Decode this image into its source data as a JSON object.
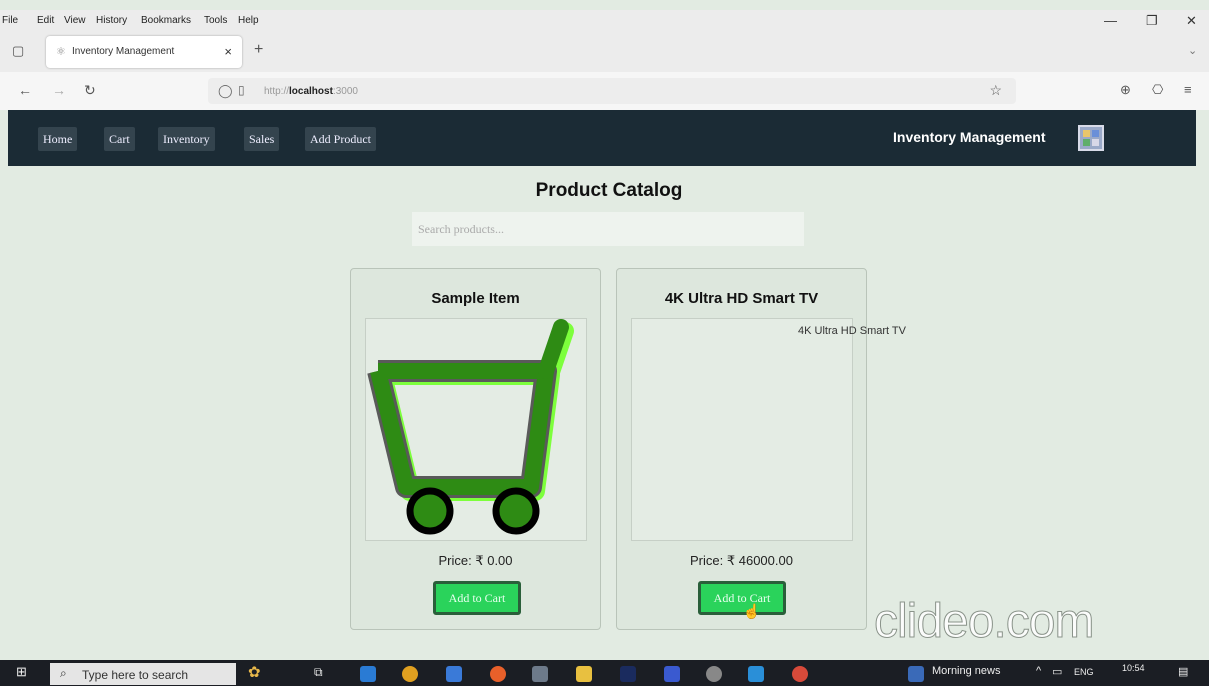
{
  "browser": {
    "menu": [
      "File",
      "Edit",
      "View",
      "History",
      "Bookmarks",
      "Tools",
      "Help"
    ],
    "tab_title": "Inventory Management",
    "url_prefix": "http://",
    "url_host": "localhost",
    "url_port": ":3000"
  },
  "nav": {
    "links": [
      "Home",
      "Cart",
      "Inventory",
      "Sales",
      "Add Product"
    ],
    "brand": "Inventory Management"
  },
  "page": {
    "title": "Product Catalog",
    "search_placeholder": "Search products..."
  },
  "products": [
    {
      "name": "Sample Item",
      "image_alt": "",
      "price": "Price: ₹ 0.00",
      "button": "Add to Cart"
    },
    {
      "name": "4K Ultra HD Smart TV",
      "image_alt": "4K Ultra HD Smart TV",
      "price": "Price: ₹ 46000.00",
      "button": "Add to Cart"
    }
  ],
  "watermark": "clideo.com",
  "taskbar": {
    "search_placeholder": "Type here to search",
    "news": "Morning news",
    "lang": "ENG",
    "time": "10:54"
  },
  "colors": {
    "nav_bg": "#1b2b35",
    "button_bg": "#2ad35b",
    "cart_green": "#2e8b14"
  }
}
